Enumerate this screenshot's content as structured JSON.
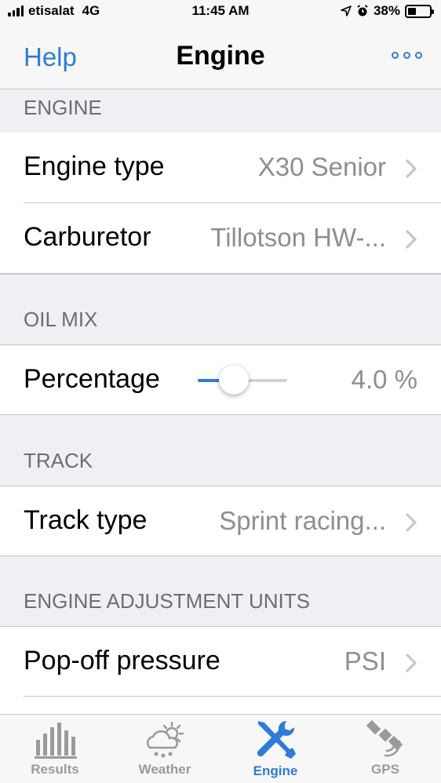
{
  "status": {
    "carrier": "etisalat",
    "network": "4G",
    "time": "11:45 AM",
    "battery": "38%",
    "battery_level": 0.38
  },
  "nav": {
    "back_label": "Help",
    "title": "Engine",
    "more_icon": "ellipsis-circle-icon",
    "accent": "#2f7bd8"
  },
  "sections": {
    "engine": {
      "header": "ENGINE",
      "rows": [
        {
          "label": "Engine type",
          "value": "X30 Senior"
        },
        {
          "label": "Carburetor",
          "value": "Tillotson HW-..."
        }
      ]
    },
    "oil_mix": {
      "header": "OIL MIX",
      "percentage_label": "Percentage",
      "percentage_value": "4.0 %",
      "slider_fraction": 0.4
    },
    "track": {
      "header": "TRACK",
      "rows": [
        {
          "label": "Track type",
          "value": "Sprint racing..."
        }
      ]
    },
    "units": {
      "header": "ENGINE ADJUSTMENT UNITS",
      "rows": [
        {
          "label": "Pop-off pressure",
          "value": "PSI"
        }
      ]
    }
  },
  "tabs": [
    {
      "label": "Results",
      "icon": "bar-chart-icon",
      "active": false
    },
    {
      "label": "Weather",
      "icon": "weather-cloud-sun-icon",
      "active": false
    },
    {
      "label": "Engine",
      "icon": "wrench-screwdriver-icon",
      "active": true
    },
    {
      "label": "GPS",
      "icon": "satellite-icon",
      "active": false
    }
  ]
}
